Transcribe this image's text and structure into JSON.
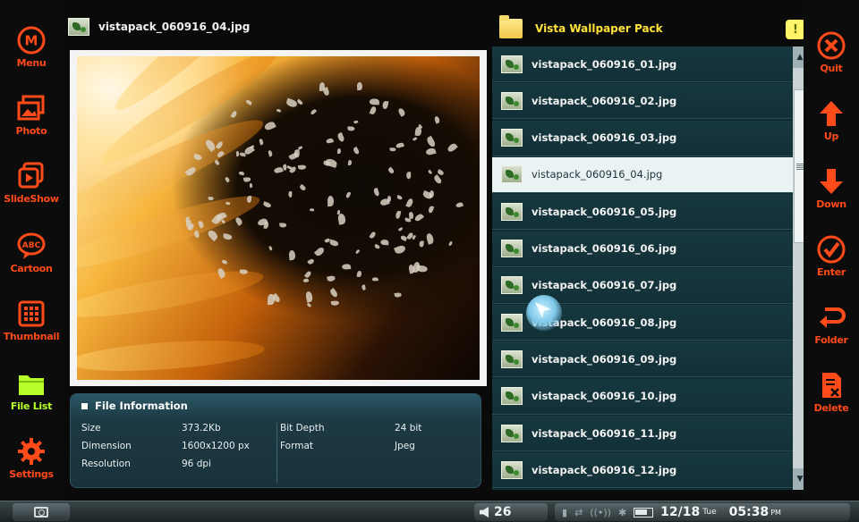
{
  "sidebar_left": [
    {
      "label": "Menu",
      "icon": "menu-m-icon"
    },
    {
      "label": "Photo",
      "icon": "photo-icon"
    },
    {
      "label": "SlideShow",
      "icon": "slideshow-icon"
    },
    {
      "label": "Cartoon",
      "icon": "cartoon-icon"
    },
    {
      "label": "Thumbnail",
      "icon": "thumbnail-icon"
    },
    {
      "label": "File List",
      "icon": "folder-icon",
      "active": true
    },
    {
      "label": "Settings",
      "icon": "gear-icon"
    }
  ],
  "sidebar_right": [
    {
      "label": "Quit",
      "icon": "close-icon"
    },
    {
      "label": "Up",
      "icon": "arrow-up-icon"
    },
    {
      "label": "Down",
      "icon": "arrow-down-icon"
    },
    {
      "label": "Enter",
      "icon": "check-icon"
    },
    {
      "label": "Folder",
      "icon": "return-icon"
    },
    {
      "label": "Delete",
      "icon": "delete-doc-icon"
    }
  ],
  "viewer": {
    "filename": "vistapack_060916_04.jpg"
  },
  "file_info": {
    "title": "File Information",
    "size_label": "Size",
    "size_value": "373.2Kb",
    "dimension_label": "Dimension",
    "dimension_value": "1600x1200 px",
    "resolution_label": "Resolution",
    "resolution_value": "96 dpi",
    "bitdepth_label": "Bit Depth",
    "bitdepth_value": "24 bit",
    "format_label": "Format",
    "format_value": "Jpeg"
  },
  "file_list": {
    "folder_name": "Vista Wallpaper Pack",
    "help_label": "!",
    "items": [
      "vistapack_060916_01.jpg",
      "vistapack_060916_02.jpg",
      "vistapack_060916_03.jpg",
      "vistapack_060916_04.jpg",
      "vistapack_060916_05.jpg",
      "vistapack_060916_06.jpg",
      "vistapack_060916_07.jpg",
      "vistapack_060916_08.jpg",
      "vistapack_060916_09.jpg",
      "vistapack_060916_10.jpg",
      "vistapack_060916_11.jpg",
      "vistapack_060916_12.jpg"
    ],
    "selected_index": 3
  },
  "statusbar": {
    "volume": "26",
    "date": "12/18",
    "day": "Tue",
    "time": "05:38",
    "ampm": "PM"
  },
  "colors": {
    "accent": "#ff4a1a",
    "active": "#b6ff2a",
    "folder_title": "#ffe23a"
  }
}
